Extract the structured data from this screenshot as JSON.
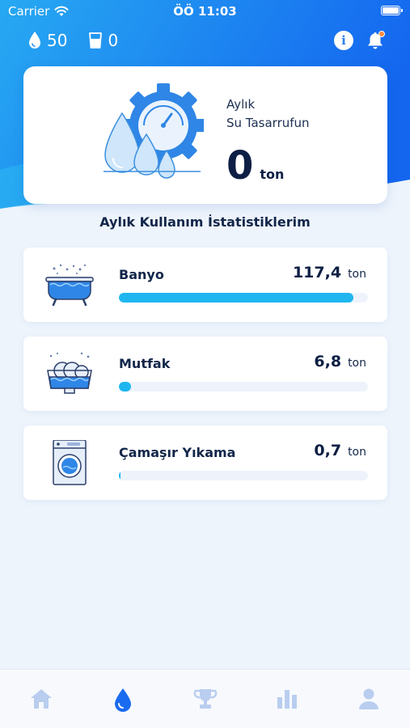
{
  "status_bar": {
    "carrier": "Carrier",
    "time": "ÖÖ 11:03"
  },
  "header": {
    "drops_count": "50",
    "glass_count": "0",
    "icons": [
      "water-drop-icon",
      "water-glass-icon",
      "info-icon",
      "bell-icon"
    ]
  },
  "saving": {
    "label_line1": "Aylık",
    "label_line2": "Su Tasarrufun",
    "value": "0",
    "unit": "ton"
  },
  "stats": {
    "title": "Aylık Kullanım İstatistiklerim",
    "items": [
      {
        "name": "Banyo",
        "value": "117,4",
        "unit": "ton",
        "level": 0.94,
        "icon": "bathtub-icon"
      },
      {
        "name": "Mutfak",
        "value": "6,8",
        "unit": "ton",
        "level": 0.05,
        "icon": "dish-basin-icon"
      },
      {
        "name": "Çamaşır Yıkama",
        "value": "0,7",
        "unit": "ton",
        "level": 0.006,
        "icon": "washing-machine-icon"
      }
    ]
  },
  "tabs": [
    {
      "icon": "home-icon",
      "active": false
    },
    {
      "icon": "water-drop-icon",
      "active": true
    },
    {
      "icon": "trophy-icon",
      "active": false
    },
    {
      "icon": "bar-chart-icon",
      "active": false
    },
    {
      "icon": "user-icon",
      "active": false
    }
  ],
  "colors": {
    "accent": "#1fb6f0",
    "header_gradient_start": "#1f9cf0",
    "header_gradient_end": "#1a6bf0",
    "tab_active": "#1a6bf0",
    "tab_inactive": "#b9cdef",
    "notification_dot": "#ff8a3d"
  }
}
